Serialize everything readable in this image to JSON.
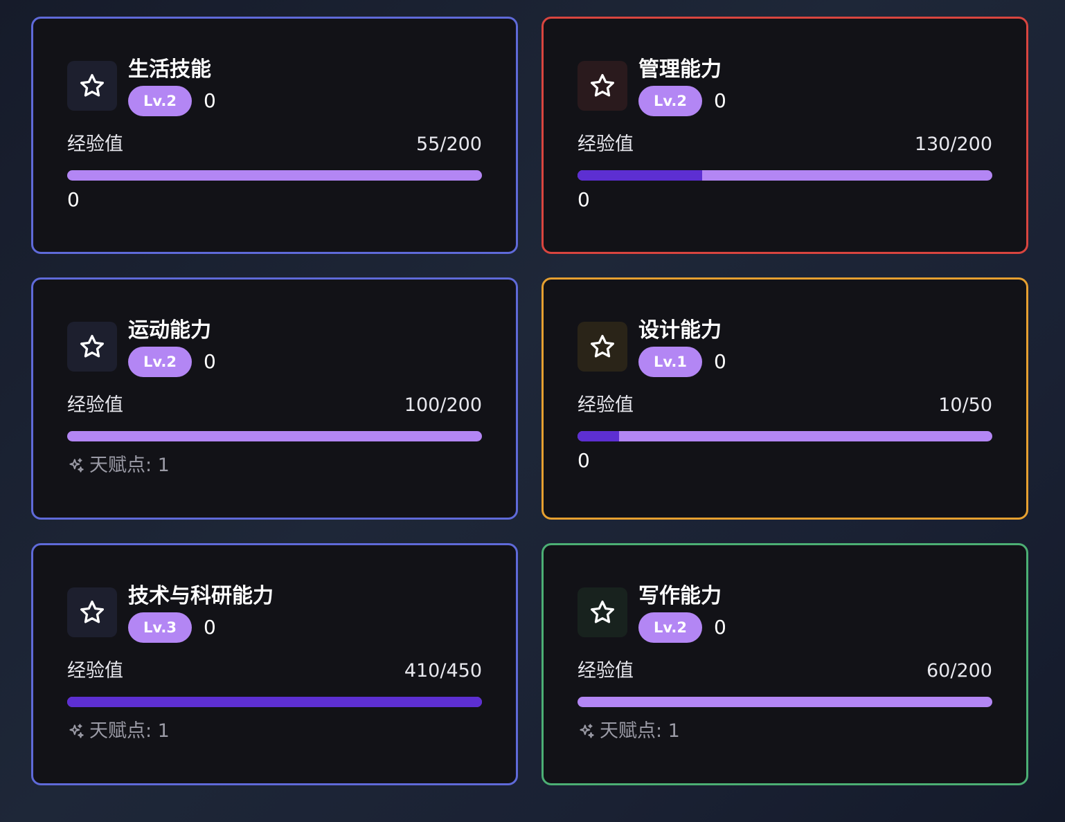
{
  "exp_label": "经验值",
  "talent_icon": "sparkle-icon",
  "skill_icon": "star-icon",
  "colors": {
    "bar_track": "#b386f4",
    "bar_fill": "#5d2fd2",
    "badge": "#b386f4",
    "card_bg": "#121217"
  },
  "cards": [
    {
      "title": "生活技能",
      "level": "Lv.2",
      "level_extra": "0",
      "exp_text": "55/200",
      "progress": 0,
      "footer": "0",
      "talent": null,
      "border": "#5f6ad9",
      "icon_bg": "#1d1f2e"
    },
    {
      "title": "管理能力",
      "level": "Lv.2",
      "level_extra": "0",
      "exp_text": "130/200",
      "progress": 0.3,
      "footer": "0",
      "talent": null,
      "border": "#d9453f",
      "icon_bg": "#2a1a1d"
    },
    {
      "title": "运动能力",
      "level": "Lv.2",
      "level_extra": "0",
      "exp_text": "100/200",
      "progress": 0,
      "footer": null,
      "talent": "天赋点: 1",
      "border": "#5f6ad9",
      "icon_bg": "#1d1f2e"
    },
    {
      "title": "设计能力",
      "level": "Lv.1",
      "level_extra": "0",
      "exp_text": "10/50",
      "progress": 0.1,
      "footer": "0",
      "talent": null,
      "border": "#e6a030",
      "icon_bg": "#2a2418"
    },
    {
      "title": "技术与科研能力",
      "level": "Lv.3",
      "level_extra": "0",
      "exp_text": "410/450",
      "progress": 1,
      "footer": null,
      "talent": "天赋点: 1",
      "border": "#5f6ad9",
      "icon_bg": "#1d1f2e"
    },
    {
      "title": "写作能力",
      "level": "Lv.2",
      "level_extra": "0",
      "exp_text": "60/200",
      "progress": 0,
      "footer": null,
      "talent": "天赋点: 1",
      "border": "#4caf74",
      "icon_bg": "#18221e"
    }
  ]
}
